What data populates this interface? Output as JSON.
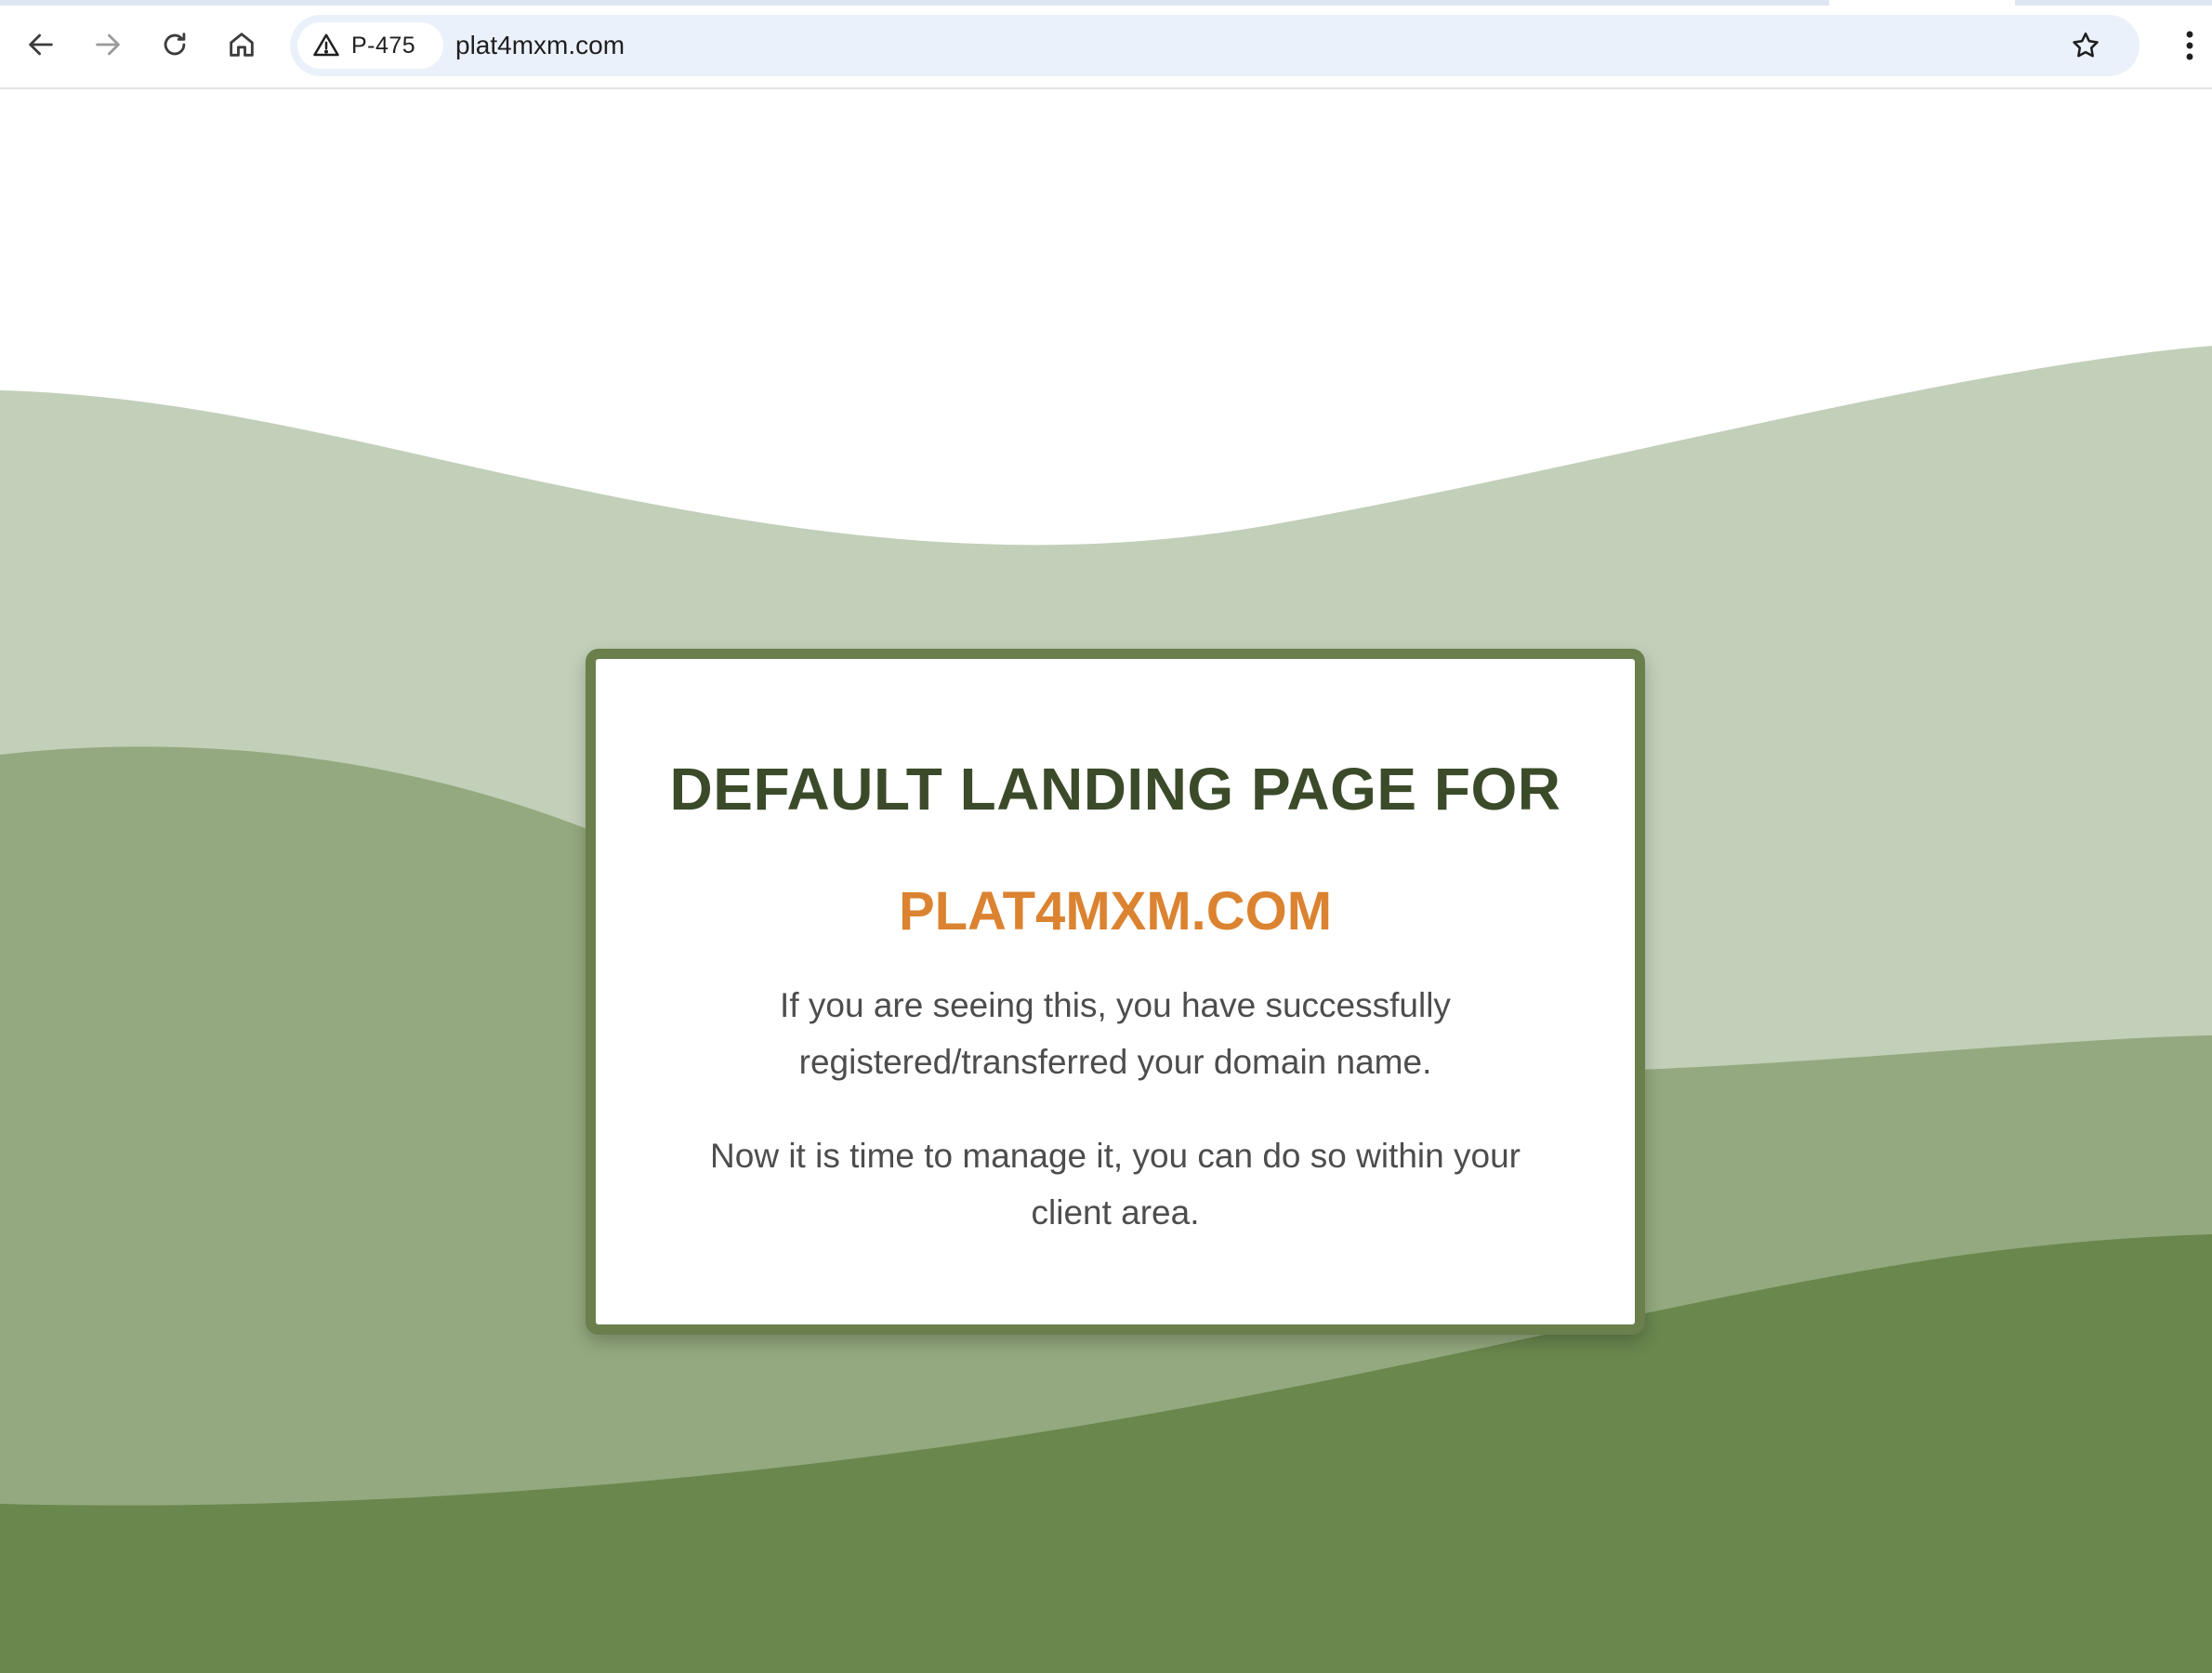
{
  "browser": {
    "security_chip_label": "P-475",
    "url": "plat4mxm.com"
  },
  "icons": {
    "back": "back-arrow-icon",
    "forward": "forward-arrow-icon",
    "reload": "reload-icon",
    "home": "home-icon",
    "warning": "warning-triangle-icon",
    "bookmark": "star-icon",
    "menu": "kebab-menu-icon"
  },
  "colors": {
    "wave_light": "#c2cfb9",
    "wave_mid": "#94a97f",
    "wave_dark": "#6a874e",
    "card_border": "#6a7f4c",
    "title": "#3b4b2a",
    "domain": "#db8331",
    "body_text": "#4d4d4d"
  },
  "card": {
    "title": "DEFAULT LANDING PAGE FOR",
    "domain": "PLAT4MXM.COM",
    "paragraph_1": "If you are seeing this, you have successfully registered/transferred your domain name.",
    "paragraph_2": "Now it is time to manage it, you can do so within your client area."
  }
}
